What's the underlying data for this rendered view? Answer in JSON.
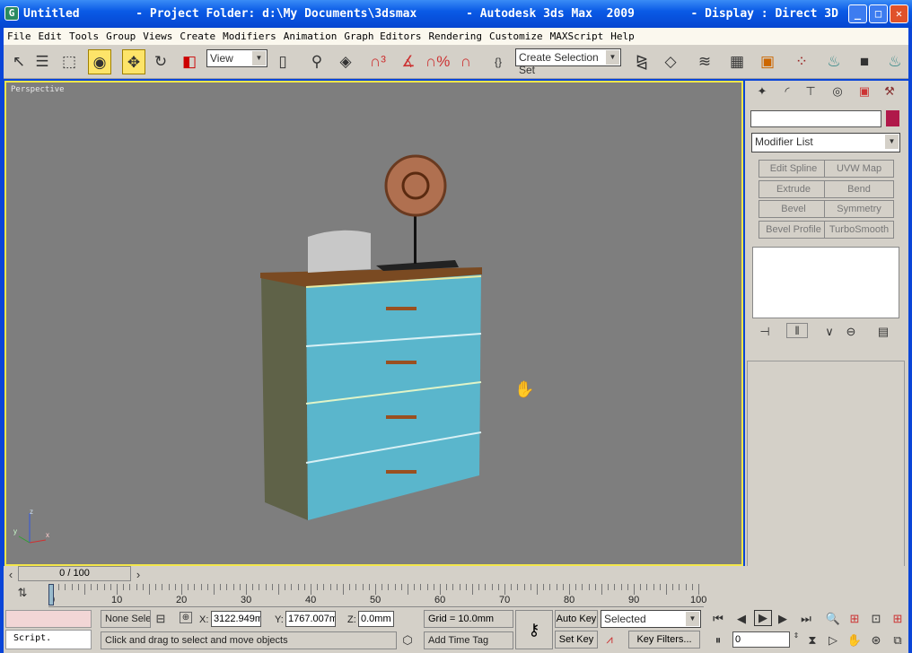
{
  "window": {
    "title": "Untitled        - Project Folder: d:\\My Documents\\3dsmax       - Autodesk 3ds Max  2009        - Display : Direct 3D",
    "app_icon": "3dsmax-icon"
  },
  "menu": [
    "File",
    "Edit",
    "Tools",
    "Group",
    "Views",
    "Create",
    "Modifiers",
    "Animation",
    "Graph Editors",
    "Rendering",
    "Customize",
    "MAXScript",
    "Help"
  ],
  "toolbar": {
    "reference_coord": "View",
    "selection_set": "Create Selection Set"
  },
  "viewport": {
    "label": "Perspective",
    "axis": {
      "x": "x",
      "y": "y",
      "z": "z"
    }
  },
  "command_panel": {
    "tabs": [
      "create",
      "modify",
      "hierarchy",
      "motion",
      "display",
      "utilities"
    ],
    "object_color": "#b0184a",
    "name_value": "",
    "modifier_list": "Modifier List",
    "modifier_buttons": [
      "Edit Spline",
      "UVW Map",
      "Extrude",
      "Bend",
      "Bevel",
      "Symmetry",
      "Bevel Profile",
      "TurboSmooth"
    ]
  },
  "timeline": {
    "frame_label": "0 / 100",
    "ticks": [
      "0",
      "10",
      "20",
      "30",
      "40",
      "50",
      "60",
      "70",
      "80",
      "90",
      "100"
    ]
  },
  "status": {
    "script": "Script.",
    "selection": "None Sele",
    "x_label": "X:",
    "x_value": "3122.949m",
    "y_label": "Y:",
    "y_value": "1767.007m",
    "z_label": "Z:",
    "z_value": "0.0mm",
    "grid": "Grid = 10.0mm",
    "prompt": "Click and drag to select and move objects",
    "add_time_tag": "Add Time Tag",
    "auto_key": "Auto Key",
    "set_key": "Set Key",
    "key_mode": "Selected",
    "key_filters": "Key Filters...",
    "current_frame": "0"
  }
}
